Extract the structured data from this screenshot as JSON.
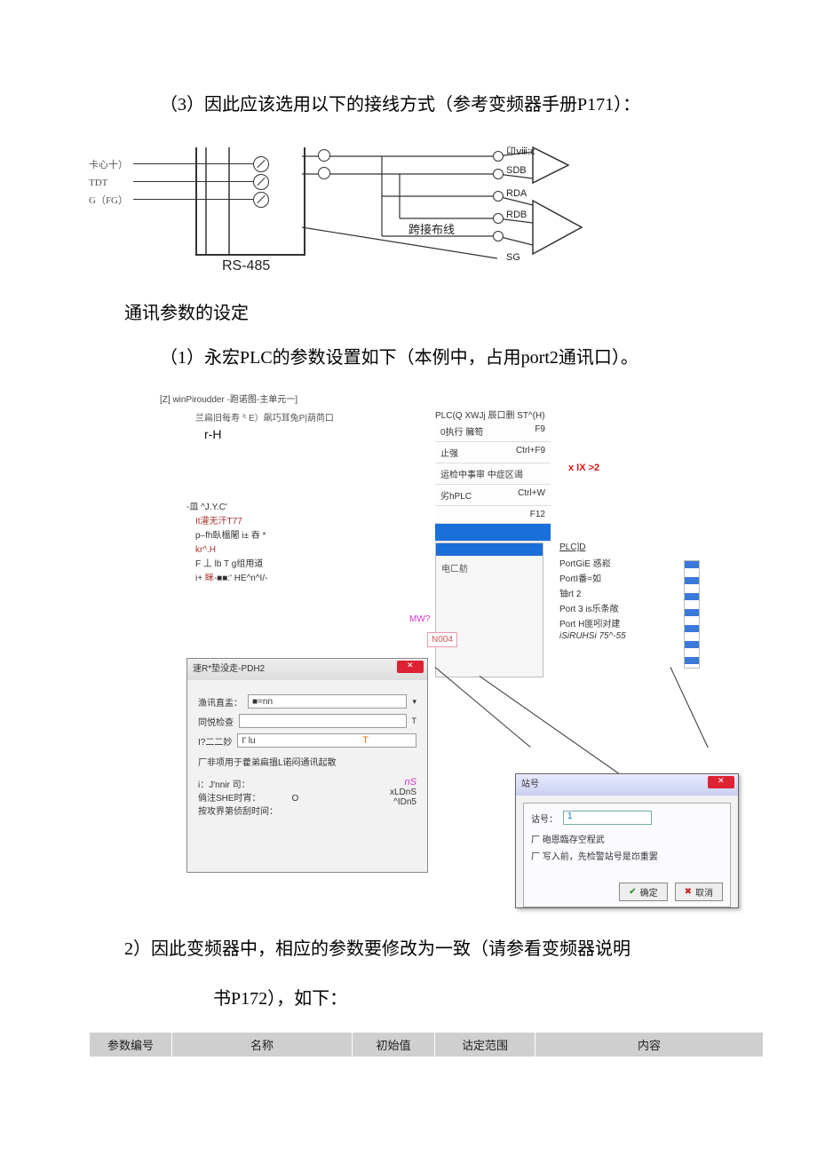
{
  "para1": "（3）因此应该选用以下的接线方式（参考变频器手册P171）：",
  "fig1": {
    "left_labels": [
      "卡心十）",
      "TDT",
      "G（FG）"
    ],
    "rs485": "RS-485",
    "mid_label": "跨接布线",
    "right_pins": [
      "卬ⅷ:x",
      "SDB",
      "RDA",
      "RDB",
      "SG"
    ]
  },
  "section_title": "通讯参数的设定",
  "para2": "（1）永宏PLC的参数设置如下（本例中，占用port2通讯口）。",
  "fig2": {
    "title": "[Z] winPiroudder -跑诺图-主单元一]",
    "menu": "兰扁旧每寿⺀E）飙巧耳兔P|葫苘口",
    "rh": "r-H",
    "plc_header": "PLC(Q XWJj 辰口删 ST^(H)",
    "plc_rows": [
      {
        "l": "0执行 臃笱",
        "r": "F9"
      },
      {
        "l": "止强",
        "r": "Ctrl+F9"
      },
      {
        "l": "运检中事审 中症区谒",
        "r": ""
      },
      {
        "l": "劣hPLC",
        "r": "Ctrl+W"
      },
      {
        "l": "",
        "r": "F12"
      }
    ],
    "xix": "x IX >2",
    "sidepanel_txt": "电匚舫",
    "mw": "MW?",
    "nbox": "N004",
    "plcd": {
      "title": "PLC]D",
      "items": [
        "PortGiE 惑崧",
        "PortI番=如",
        "",
        "铀rt 2",
        "Port 3 is乐条敞",
        "Port H匪吲对建"
      ],
      "isiruh": "iSiRUHSi 75^-55"
    },
    "dlg1": {
      "title": "速R*垫没走-PDH2",
      "rows": [
        {
          "label": "渔讯直盂：",
          "value": "■=nn"
        },
        {
          "label": "同悦检查",
          "value": ""
        },
        {
          "label": "I?二二妙",
          "value": "I' lu"
        }
      ],
      "note": "厂非项用于藿弟扁搵L诺闷通讯起散",
      "extra": [
        "i：J'nnir 司：",
        "倘注SHE时宵：　　　　O",
        "按攻界第侦刮时间："
      ],
      "right_col": [
        "nS",
        "xLDnS",
        "^IDn5"
      ]
    },
    "dlg2": {
      "title": "站号",
      "field_label": "诂号：",
      "field_value": "1",
      "chk1": "厂 砲恩臨存空程武",
      "chk2": "厂 写入前，先检警站号是岇重罢",
      "ok": "确定",
      "cancel": "取消"
    }
  },
  "para3a": "2）因此变频器中，相应的参数要修改为一致（请参看变频器说明",
  "para3b": "书P172），如下：",
  "table_headers": [
    "参数编号",
    "名称",
    "初始值",
    "诂定范围",
    "内容"
  ]
}
